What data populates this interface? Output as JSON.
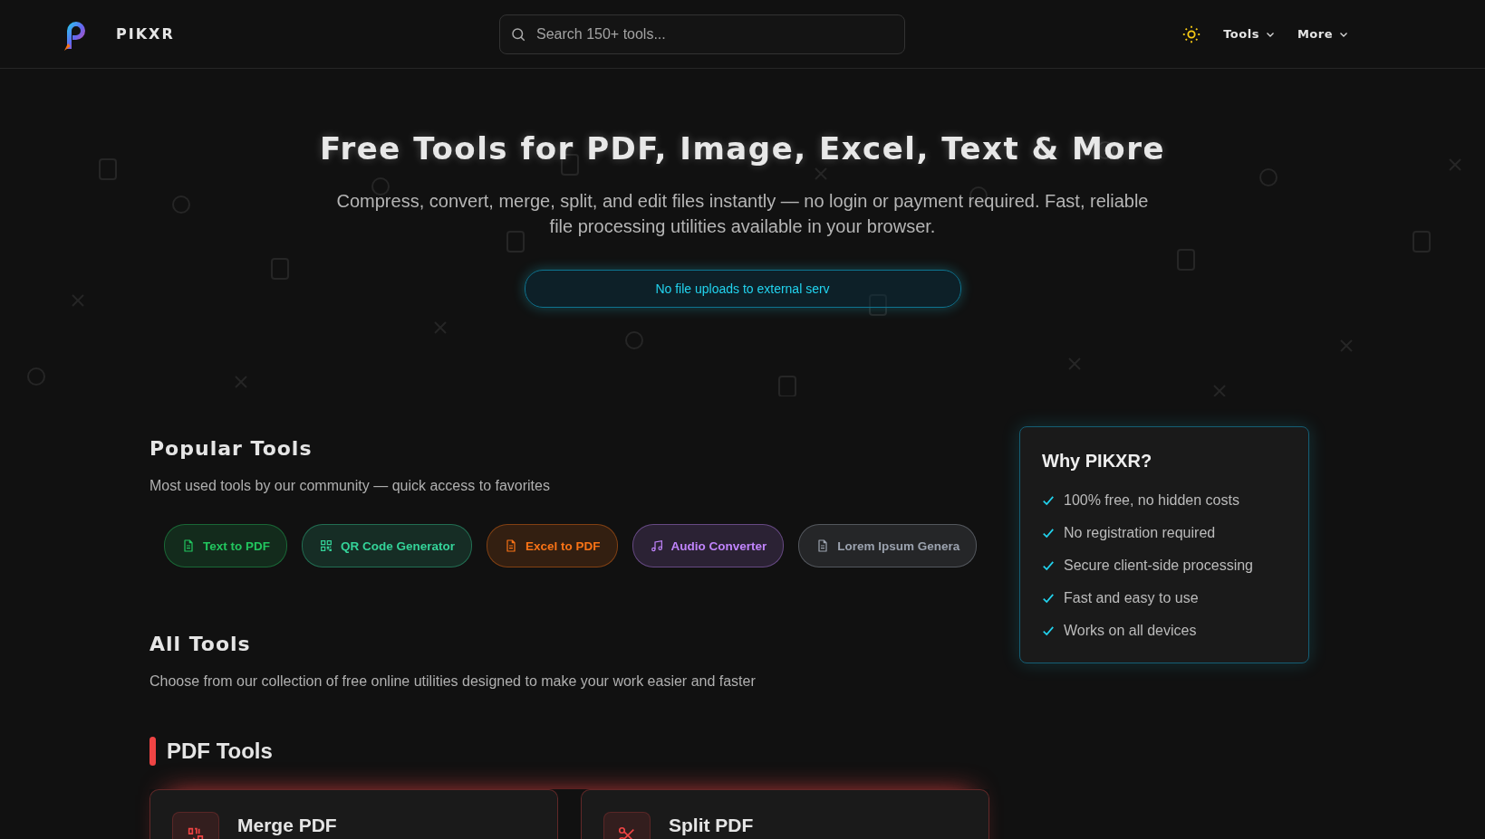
{
  "header": {
    "brand": "PIKXR",
    "search": {
      "placeholder": "Search 150+ tools..."
    },
    "menus": [
      {
        "label": "Tools"
      },
      {
        "label": "More"
      }
    ]
  },
  "hero": {
    "title": "Free Tools for PDF, Image, Excel, Text & More",
    "subtitle": "Compress, convert, merge, split, and edit files instantly — no login or payment required. Fast, reliable file processing utilities available in your browser.",
    "badge": "No file uploads to external serv"
  },
  "popular": {
    "title": "Popular Tools",
    "subtitle": "Most used tools by our community — quick access to favorites",
    "tools": [
      {
        "label": "Text to PDF",
        "kind": "document",
        "color": "#22c55e"
      },
      {
        "label": "QR Code Generator",
        "kind": "qr",
        "color": "#34d399"
      },
      {
        "label": "Excel to PDF",
        "kind": "document",
        "color": "#f97316"
      },
      {
        "label": "Audio Converter",
        "kind": "audio",
        "color": "#c084fc"
      },
      {
        "label": "Lorem Ipsum Genera",
        "kind": "document",
        "color": "#9ca3af"
      }
    ]
  },
  "why": {
    "title": "Why PIKXR?",
    "points": [
      "100% free, no hidden costs",
      "No registration required",
      "Secure client-side processing",
      "Fast and easy to use",
      "Works on all devices"
    ]
  },
  "all_tools": {
    "title": "All Tools",
    "subtitle": "Choose from our collection of free online utilities designed to make your work easier and faster"
  },
  "categories": [
    {
      "title": "PDF Tools",
      "color": "#ef4444",
      "tools": [
        {
          "name": "Merge PDF",
          "kind": "merge"
        },
        {
          "name": "Split PDF",
          "kind": "split"
        }
      ]
    }
  ]
}
